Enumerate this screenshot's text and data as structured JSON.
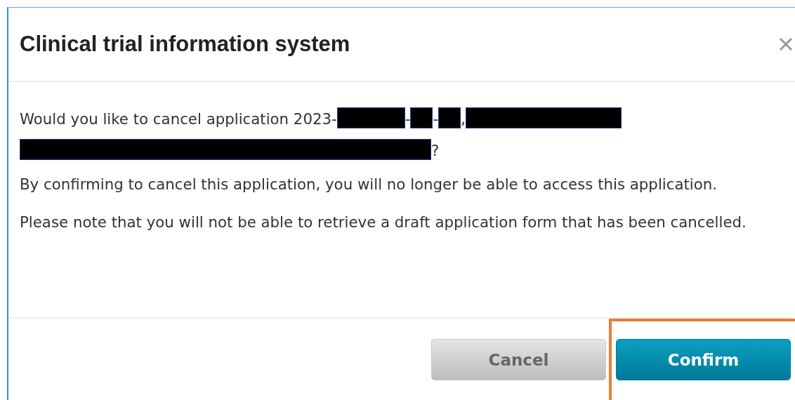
{
  "dialog": {
    "title": "Clinical trial information system",
    "question": [
      {
        "kind": "text",
        "text": "Would you like to cancel application 2023-"
      },
      {
        "kind": "redacted"
      },
      {
        "kind": "text",
        "text": "-"
      },
      {
        "kind": "redacted"
      },
      {
        "kind": "text",
        "text": "-"
      },
      {
        "kind": "redacted"
      },
      {
        "kind": "text",
        "text": ","
      },
      {
        "kind": "redacted"
      },
      {
        "kind": "break"
      },
      {
        "kind": "redacted"
      },
      {
        "kind": "text",
        "text": "?"
      }
    ],
    "paragraphs": [
      "By confirming to cancel this application, you will no longer be able to access this application.",
      "Please note that you will not be able to retrieve a draft application form that has been cancelled."
    ],
    "buttons": [
      {
        "label": "Cancel",
        "kind": "secondary",
        "highlighted": false
      },
      {
        "label": "Confirm",
        "kind": "primary",
        "highlighted": true
      }
    ]
  }
}
